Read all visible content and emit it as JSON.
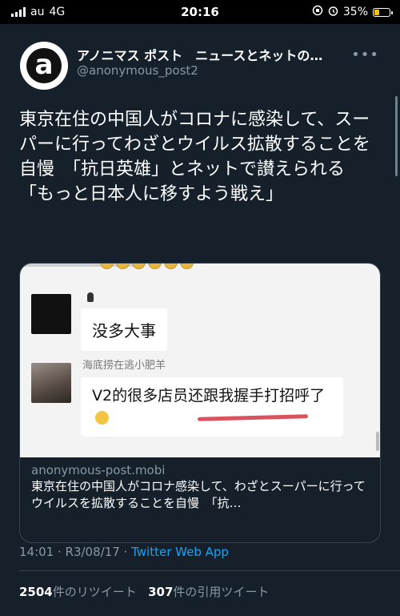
{
  "status_bar": {
    "carrier": "au",
    "network": "4G",
    "time": "20:16",
    "battery_percent": "35%",
    "battery_level": 0.35,
    "battery_color": "#f5c400"
  },
  "tweet": {
    "display_name": "アノニマス ポスト　ニュースとネットの…",
    "handle": "@anonymous_post2",
    "avatar_letter": "a",
    "more_icon": "more-horizontal-icon",
    "text": "東京在住の中国人がコロナに感染して、スーパーに行ってわざとウイルス拡散することを自慢　「抗日英雄」とネットで讃えられる　「もっと日本人に移すよう戦え」",
    "card": {
      "image": {
        "message1": "没多大事",
        "sender_name": "海底捞在逃小肥羊",
        "message2": "V2的很多店员还跟我握手打招呼了"
      },
      "domain": "anonymous-post.mobi",
      "title": "東京在住の中国人がコロナ感染して、わざとスーパーに行ってウイルスを拡散することを自慢　「抗…"
    },
    "timestamp": "14:01 · R3/08/17 · ",
    "source_app": "Twitter Web App",
    "retweet_count": "2504",
    "retweet_label": "件のリツイート",
    "quote_count": "307",
    "quote_label": "件の引用ツイート"
  },
  "colors": {
    "background": "#15202b",
    "secondary_text": "#8899a6",
    "link": "#1da1f2"
  }
}
